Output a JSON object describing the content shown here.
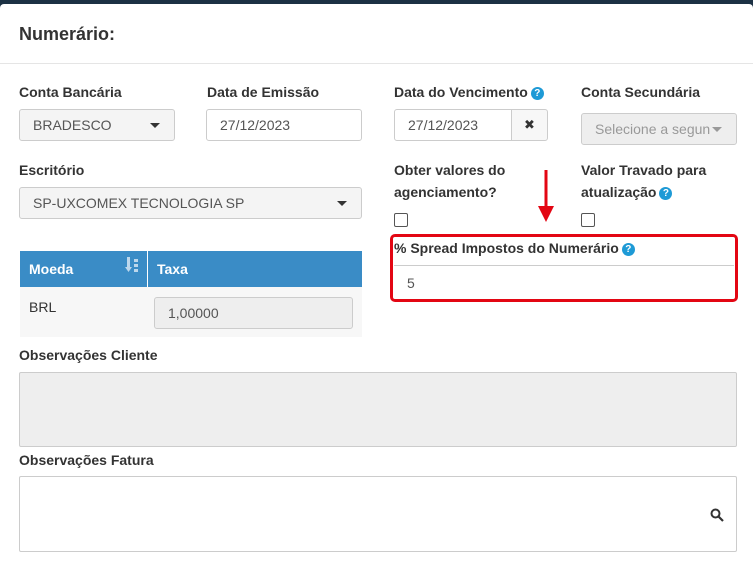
{
  "modal": {
    "title": "Numerário:"
  },
  "fields": {
    "conta_bancaria": {
      "label": "Conta Bancária",
      "value": "BRADESCO"
    },
    "data_emissao": {
      "label": "Data de Emissão",
      "value": "27/12/2023"
    },
    "data_vencimento": {
      "label": "Data do Vencimento",
      "value": "27/12/2023",
      "clear_glyph": "✖"
    },
    "conta_secundaria": {
      "label": "Conta Secundária",
      "placeholder": "Selecione a segun"
    },
    "escritorio": {
      "label": "Escritório",
      "value": "SP-UXCOMEX TECNOLOGIA SP"
    },
    "obter_valores": {
      "label_line1": "Obter valores do",
      "label_line2": "agenciamento?",
      "checked": false
    },
    "valor_travado": {
      "label_line1": "Valor Travado para",
      "label_line2": "atualização",
      "checked": false
    },
    "spread": {
      "label": "% Spread Impostos do Numerário",
      "value": "5"
    },
    "obs_cliente": {
      "label": "Observações Cliente",
      "value": ""
    },
    "obs_fatura": {
      "label": "Observações Fatura",
      "value": ""
    }
  },
  "currency_table": {
    "headers": [
      "Moeda",
      "Taxa"
    ],
    "rows": [
      {
        "moeda": "BRL",
        "taxa": "1,00000"
      }
    ]
  },
  "help_icon": "?",
  "colors": {
    "accent": "#3a8cc6",
    "help": "#1e9ad6",
    "highlight": "#e30613"
  }
}
